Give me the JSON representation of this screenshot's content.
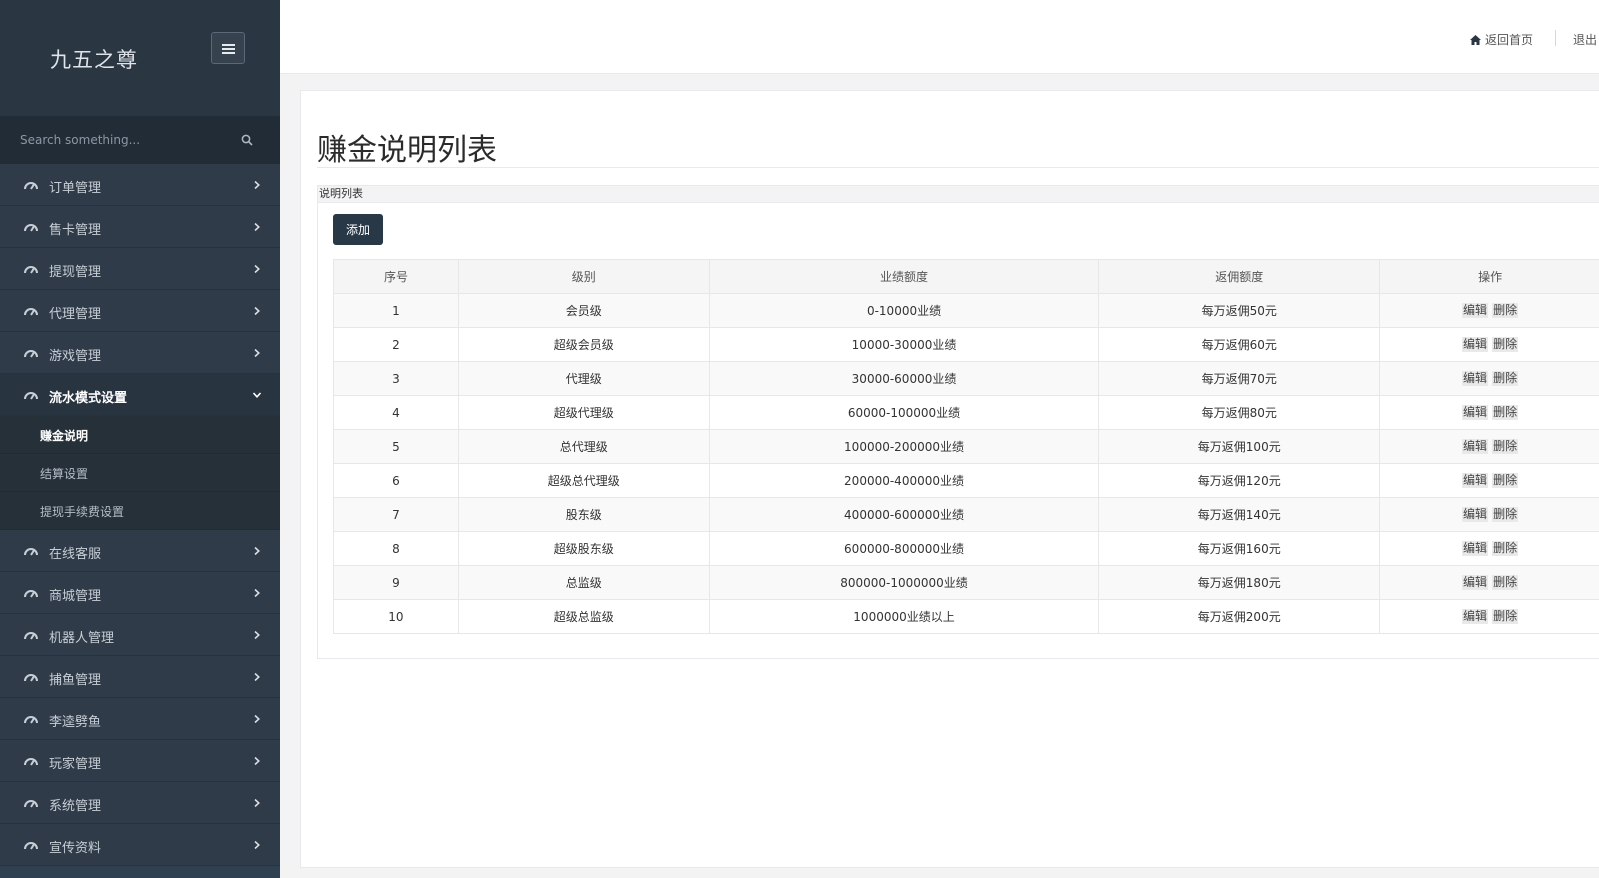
{
  "brand": {
    "name": "九五之尊"
  },
  "search": {
    "placeholder": "Search something..."
  },
  "sidebar": {
    "items": [
      {
        "label": "订单管理"
      },
      {
        "label": "售卡管理"
      },
      {
        "label": "提现管理"
      },
      {
        "label": "代理管理"
      },
      {
        "label": "游戏管理"
      },
      {
        "label": "流水模式设置",
        "open": true,
        "children": [
          {
            "label": "赚金说明",
            "active": true
          },
          {
            "label": "结算设置"
          },
          {
            "label": "提现手续费设置"
          }
        ]
      },
      {
        "label": "在线客服"
      },
      {
        "label": "商城管理"
      },
      {
        "label": "机器人管理"
      },
      {
        "label": "捕鱼管理"
      },
      {
        "label": "李逵劈鱼"
      },
      {
        "label": "玩家管理"
      },
      {
        "label": "系统管理"
      },
      {
        "label": "宣传资料"
      }
    ]
  },
  "topbar": {
    "home_label": "返回首页",
    "logout_label": "退出"
  },
  "page": {
    "title": "赚金说明列表",
    "box_title": "说明列表",
    "add_label": "添加"
  },
  "table": {
    "headers": [
      "序号",
      "级别",
      "业绩额度",
      "返佣额度",
      "操作"
    ],
    "rows": [
      [
        "1",
        "会员级",
        "0-10000业绩",
        "每万返佣50元"
      ],
      [
        "2",
        "超级会员级",
        "10000-30000业绩",
        "每万返佣60元"
      ],
      [
        "3",
        "代理级",
        "30000-60000业绩",
        "每万返佣70元"
      ],
      [
        "4",
        "超级代理级",
        "60000-100000业绩",
        "每万返佣80元"
      ],
      [
        "5",
        "总代理级",
        "100000-200000业绩",
        "每万返佣100元"
      ],
      [
        "6",
        "超级总代理级",
        "200000-400000业绩",
        "每万返佣120元"
      ],
      [
        "7",
        "股东级",
        "400000-600000业绩",
        "每万返佣140元"
      ],
      [
        "8",
        "超级股东级",
        "600000-800000业绩",
        "每万返佣160元"
      ],
      [
        "9",
        "总监级",
        "800000-1000000业绩",
        "每万返佣180元"
      ],
      [
        "10",
        "超级总监级",
        "1000000业绩以上",
        "每万返佣200元"
      ]
    ],
    "edit_label": "编辑",
    "delete_label": "删除"
  },
  "colors": {
    "sidebar_bg": "#2f4050",
    "button_bg": "#293846",
    "accent": "#ffffff"
  },
  "icons": {
    "nav": "dashboard-gauge-icon",
    "search": "search-icon",
    "home": "home-icon",
    "toggle": "hamburger-icon"
  }
}
